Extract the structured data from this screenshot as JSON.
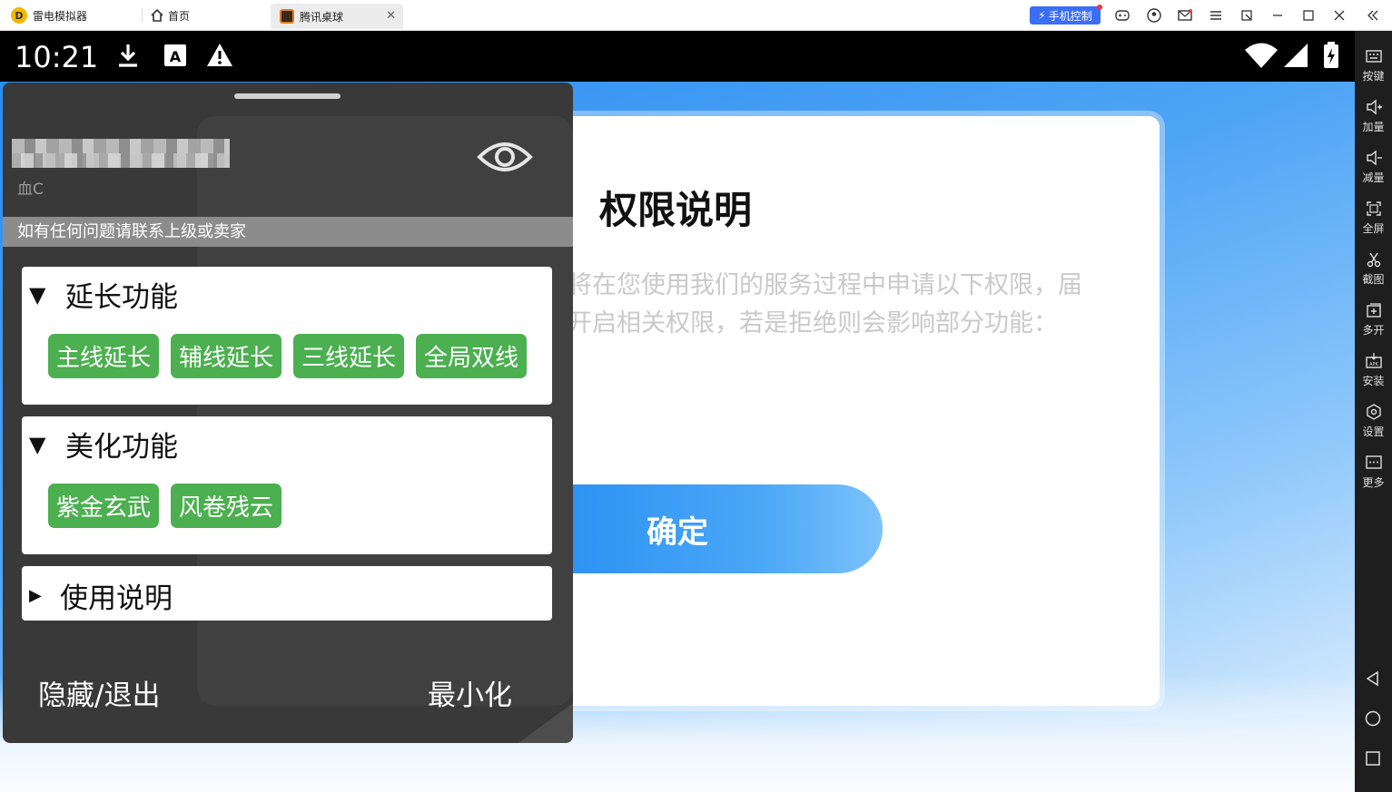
{
  "window": {
    "app_name": "雷电模拟器",
    "tabs": [
      {
        "label": "首页"
      },
      {
        "label": "腾讯桌球"
      }
    ],
    "phone_control_label": "手机控制"
  },
  "status_bar": {
    "time": "10:21"
  },
  "dialog": {
    "title": "权限说明",
    "text_line1": "将在您使用我们的服务过程中申请以下权限，届",
    "text_line2": "开启相关权限，若是拒绝则会影响部分功能：",
    "confirm_label": "确定"
  },
  "mod_menu": {
    "blood_label": "血C",
    "notice": "如有任何问题请联系上级或卖家",
    "sections": [
      {
        "title": "延长功能",
        "expanded": true,
        "chips": [
          "主线延长",
          "辅线延长",
          "三线延长",
          "全局双线"
        ]
      },
      {
        "title": "美化功能",
        "expanded": true,
        "chips": [
          "紫金玄武",
          "风卷残云"
        ]
      },
      {
        "title": "使用说明",
        "expanded": false,
        "chips": []
      }
    ],
    "hide_exit_label": "隐藏/退出",
    "minimize_label": "最小化",
    "accent_color": "#4caf50"
  },
  "sidebar": {
    "items": [
      {
        "label": "按键",
        "icon": "keyboard-icon"
      },
      {
        "label": "加量",
        "icon": "volume-up-icon"
      },
      {
        "label": "减量",
        "icon": "volume-down-icon"
      },
      {
        "label": "全屏",
        "icon": "fullscreen-icon"
      },
      {
        "label": "截图",
        "icon": "scissors-icon"
      },
      {
        "label": "多开",
        "icon": "multi-instance-icon"
      },
      {
        "label": "安装",
        "icon": "apk-install-icon"
      },
      {
        "label": "设置",
        "icon": "gear-icon"
      },
      {
        "label": "更多",
        "icon": "more-icon"
      }
    ]
  }
}
